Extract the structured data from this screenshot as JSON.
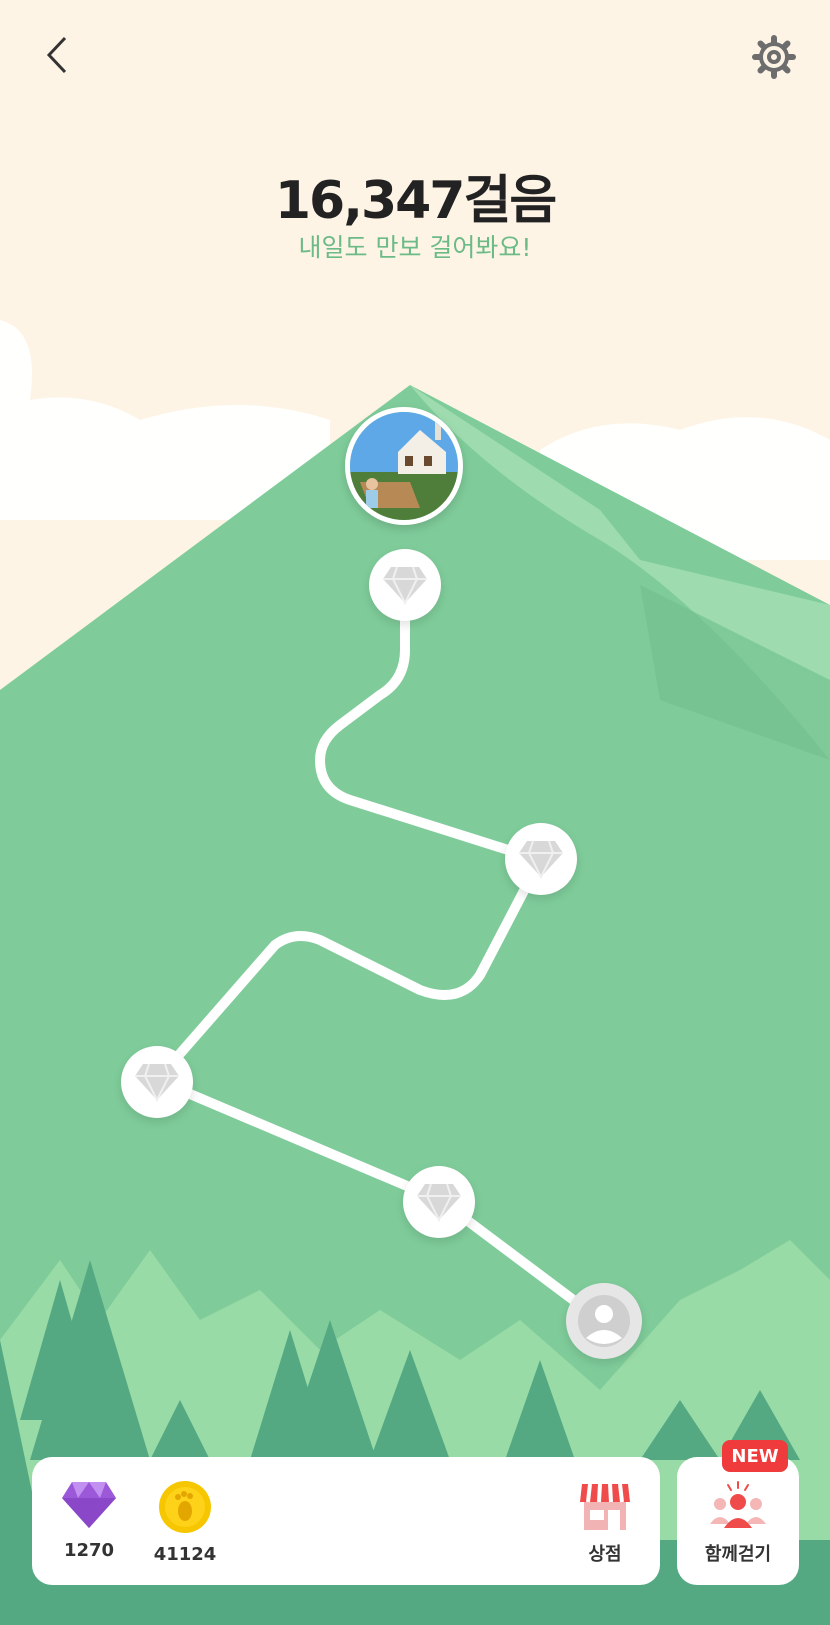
{
  "header": {
    "back_icon": "chevron-left-icon",
    "settings_icon": "gear-icon"
  },
  "summary": {
    "steps": "16,347걸음",
    "message": "내일도 만보 걸어봐요!"
  },
  "route": {
    "milestone_icon": "diamond-icon",
    "avatar_icon": "user-icon",
    "completed_milestones": 0,
    "total_milestones": 5
  },
  "wallet": {
    "gems": "1270",
    "coins": "41124",
    "gem_icon": "purple-diamond-icon",
    "coin_icon": "footprint-coin-icon"
  },
  "shop": {
    "label": "상점",
    "icon": "storefront-icon"
  },
  "walk_together": {
    "label": "함께걷기",
    "badge": "NEW",
    "icon": "group-people-icon"
  },
  "colors": {
    "sky": "#fdf4e6",
    "mountain": "#7fcc9a",
    "accent_green": "#6cba86",
    "badge_red": "#ef3b3b"
  }
}
